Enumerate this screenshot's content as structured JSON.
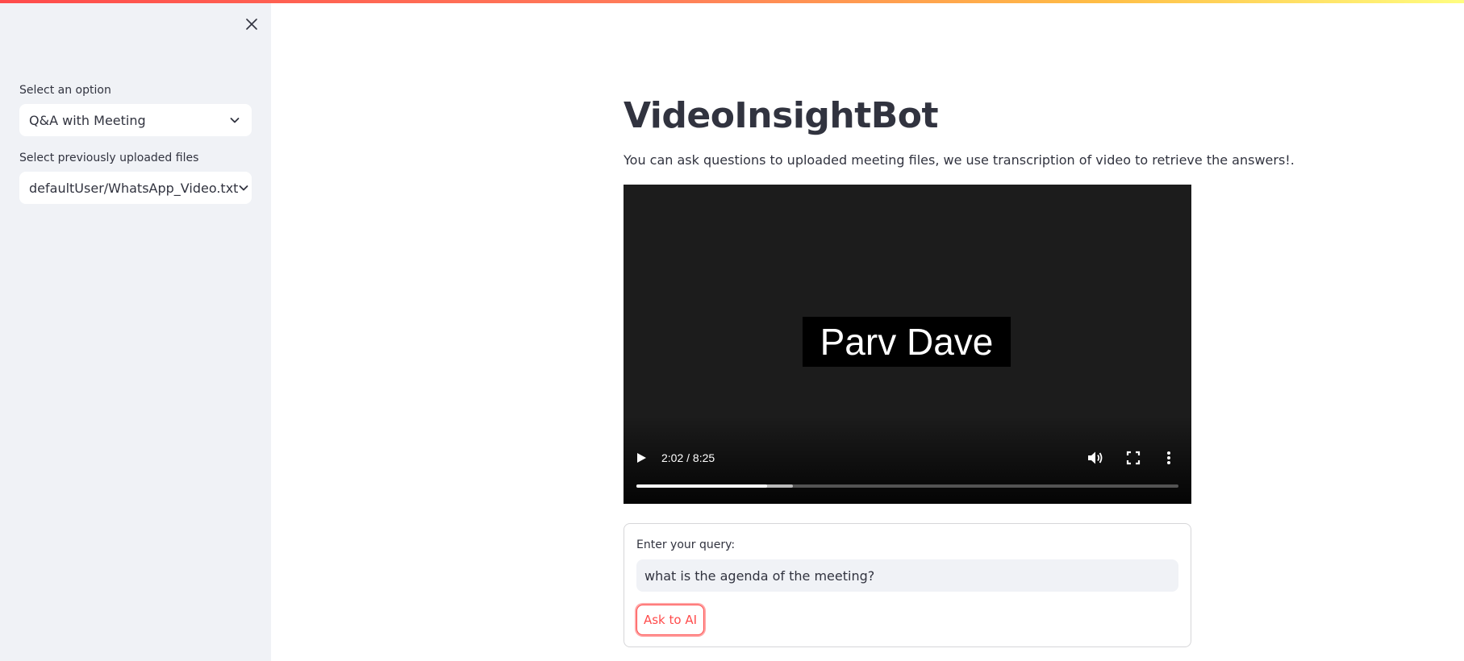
{
  "sidebar": {
    "option_label": "Select an option",
    "option_value": "Q&A with Meeting",
    "files_label": "Select previously uploaded files",
    "files_value": "defaultUser/WhatsApp_Video.txt"
  },
  "main": {
    "title": "VideoInsightBot",
    "description": "You can ask questions to uploaded meeting files, we use transcription of video to retrieve the answers!."
  },
  "video": {
    "caption": "Parv Dave",
    "time": "2:02 / 8:25",
    "played_fraction": 0.2416,
    "buffered_fraction": 0.288
  },
  "query_form": {
    "label": "Enter your query:",
    "value": "what is the agenda of the meeting?",
    "button_label": "Ask to AI"
  },
  "colors": {
    "accent": "#ff4b4b",
    "sidebar_bg": "#f0f2f6",
    "text": "#31333f"
  },
  "icons": {
    "sidebar_close": "close-icon",
    "dropdown": "chevron-down-icon",
    "play": "play-icon",
    "volume": "volume-icon",
    "fullscreen": "fullscreen-icon",
    "more": "more-vertical-icon"
  }
}
